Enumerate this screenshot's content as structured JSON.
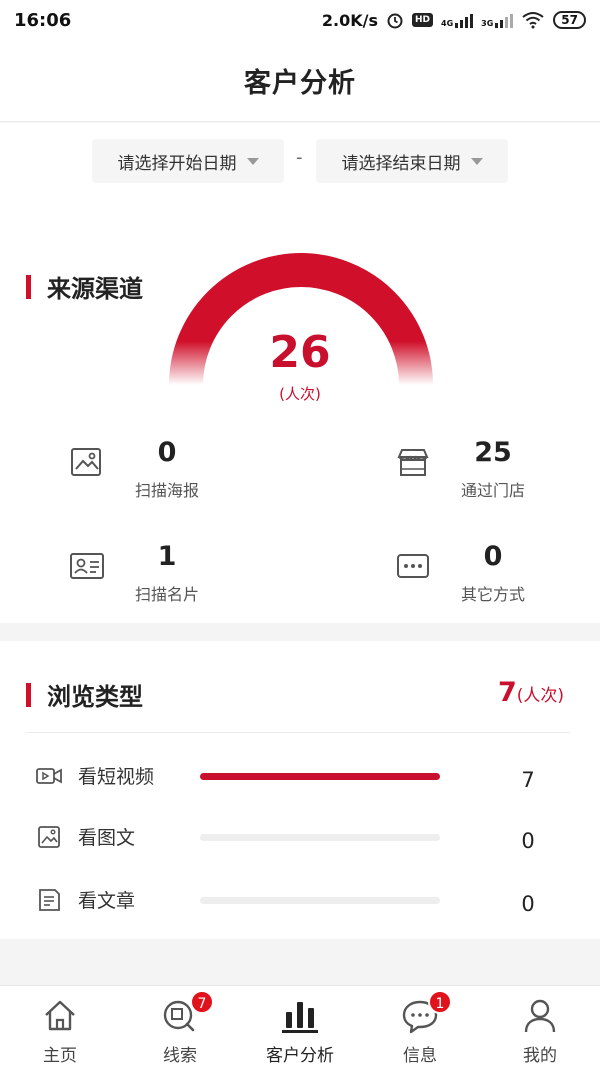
{
  "status_bar": {
    "time": "16:06",
    "net_speed": "2.0K/s",
    "hd_label": "HD",
    "net_4g": "4G",
    "net_3g": "3G",
    "battery": "57"
  },
  "header": {
    "title": "客户分析"
  },
  "date_filter": {
    "start_placeholder": "请选择开始日期",
    "separator": "-",
    "end_placeholder": "请选择结束日期"
  },
  "source_section": {
    "title": "来源渠道",
    "total": "26",
    "unit": "(人次)",
    "stats": [
      {
        "value": "0",
        "label": "扫描海报",
        "icon": "image-icon"
      },
      {
        "value": "25",
        "label": "通过门店",
        "icon": "store-icon"
      },
      {
        "value": "1",
        "label": "扫描名片",
        "icon": "business-card-icon"
      },
      {
        "value": "0",
        "label": "其它方式",
        "icon": "more-dots-icon"
      }
    ]
  },
  "browse_section": {
    "title": "浏览类型",
    "total": "7",
    "unit": "(人次)",
    "rows": [
      {
        "label": "看短视频",
        "value": "7",
        "fraction": 1.0,
        "icon": "video-icon"
      },
      {
        "label": "看图文",
        "value": "0",
        "fraction": 0.0,
        "icon": "image-text-icon"
      },
      {
        "label": "看文章",
        "value": "0",
        "fraction": 0.0,
        "icon": "article-icon"
      }
    ]
  },
  "tab_bar": {
    "tabs": [
      {
        "label": "主页",
        "icon": "home-icon",
        "badge": ""
      },
      {
        "label": "线索",
        "icon": "clue-search-icon",
        "badge": "7"
      },
      {
        "label": "客户分析",
        "icon": "bar-chart-icon",
        "badge": "",
        "active": true
      },
      {
        "label": "信息",
        "icon": "message-icon",
        "badge": "1"
      },
      {
        "label": "我的",
        "icon": "user-icon",
        "badge": ""
      }
    ]
  },
  "colors": {
    "accent": "#c8102e",
    "badge": "#e0131c"
  }
}
